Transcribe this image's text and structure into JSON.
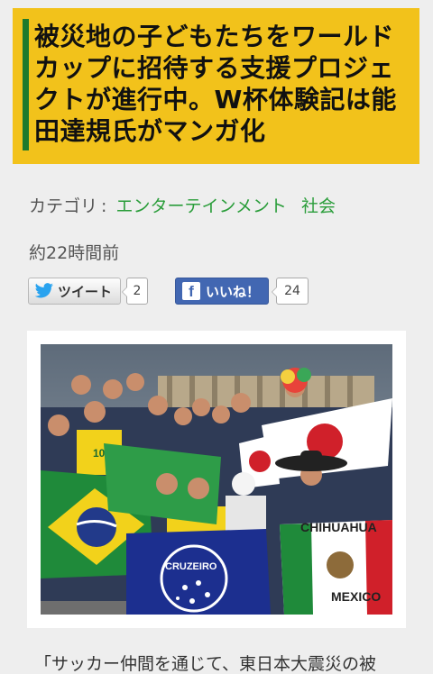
{
  "article": {
    "title": "被災地の子どもたちをワールドカップに招待する支援プロジェクトが進行中。W杯体験記は能田達規氏がマンガ化",
    "category_label": "カテゴリ",
    "category_sep": ":",
    "categories": [
      "エンターテインメント",
      "社会"
    ],
    "time_ago": "約22時間前",
    "body_first_line": "「サッカー仲間を通じて、東日本大震災の被"
  },
  "share": {
    "tweet_label": "ツイート",
    "tweet_count": "2",
    "like_label": "いいね！",
    "like_count": "24"
  },
  "photo": {
    "flag_texts": [
      "CHIHUAHUA",
      "MEXICO",
      "CRUZEIRO",
      "10"
    ]
  },
  "colors": {
    "title_bg": "#f2c21b",
    "title_accent": "#1f7a2c",
    "link_green": "#2a9d3a",
    "facebook_blue": "#4267b2"
  }
}
